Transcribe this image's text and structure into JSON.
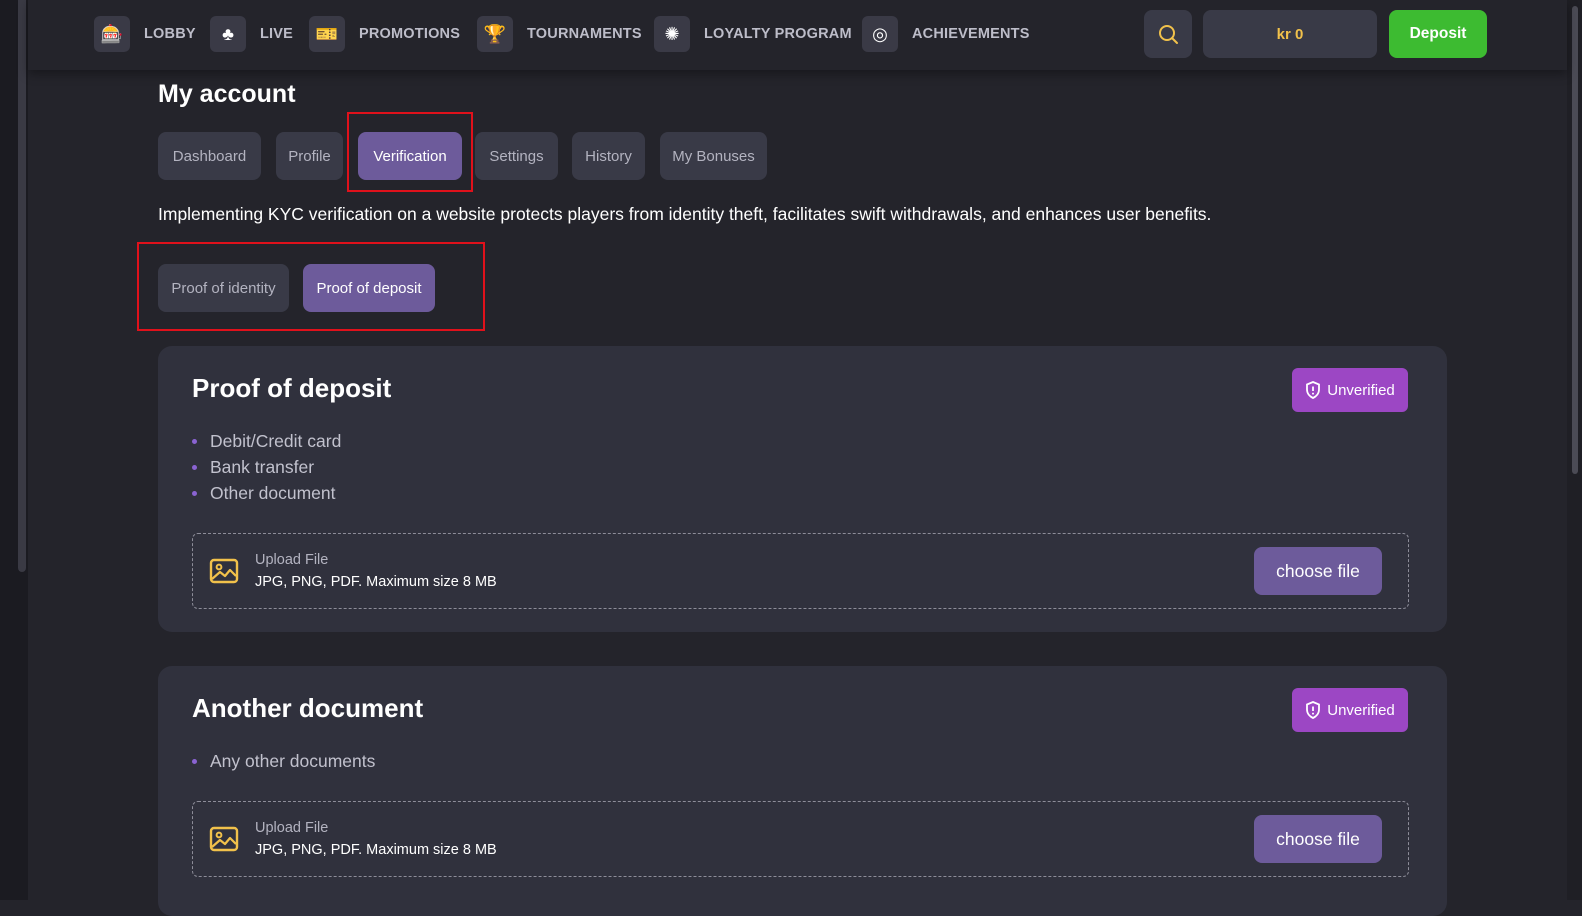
{
  "nav": {
    "items": [
      {
        "label": "LOBBY",
        "icon": "slot-machine-icon"
      },
      {
        "label": "LIVE",
        "icon": "live-dealer-icon"
      },
      {
        "label": "PROMOTIONS",
        "icon": "ticket-icon"
      },
      {
        "label": "TOURNAMENTS",
        "icon": "trophy-icon"
      },
      {
        "label": "LOYALTY PROGRAM",
        "icon": "loyalty-emblem-icon"
      },
      {
        "label": "ACHIEVEMENTS",
        "icon": "target-icon"
      }
    ],
    "search_icon": "search-icon",
    "balance": "kr 0",
    "deposit_label": "Deposit"
  },
  "page": {
    "title": "My account",
    "tabs": [
      {
        "label": "Dashboard",
        "active": false
      },
      {
        "label": "Profile",
        "active": false
      },
      {
        "label": "Verification",
        "active": true
      },
      {
        "label": "Settings",
        "active": false
      },
      {
        "label": "History",
        "active": false
      },
      {
        "label": "My Bonuses",
        "active": false
      }
    ],
    "intro": "Implementing KYC verification on a website protects players from identity theft, facilitates swift withdrawals, and enhances user benefits.",
    "subtabs": [
      {
        "label": "Proof of identity",
        "active": false
      },
      {
        "label": "Proof of deposit",
        "active": true
      }
    ]
  },
  "cards": [
    {
      "title": "Proof of deposit",
      "status": "Unverified",
      "items": [
        "Debit/Credit card",
        "Bank transfer",
        "Other document"
      ],
      "upload_label": "Upload File",
      "upload_hint": "JPG, PNG, PDF. Maximum size 8 MB",
      "button_label": "choose file"
    },
    {
      "title": "Another document",
      "status": "Unverified",
      "items": [
        "Any other documents"
      ],
      "upload_label": "Upload File",
      "upload_hint": "JPG, PNG, PDF. Maximum size 8 MB",
      "button_label": "choose file"
    }
  ],
  "colors": {
    "background": "#24242b",
    "surface": "#30313d",
    "accent": "#6d5b9b",
    "deposit_green": "#3dbb31",
    "badge_purple": "#9c47c4",
    "balance_gold": "#f1c14b",
    "highlight_red": "#e0111b"
  }
}
